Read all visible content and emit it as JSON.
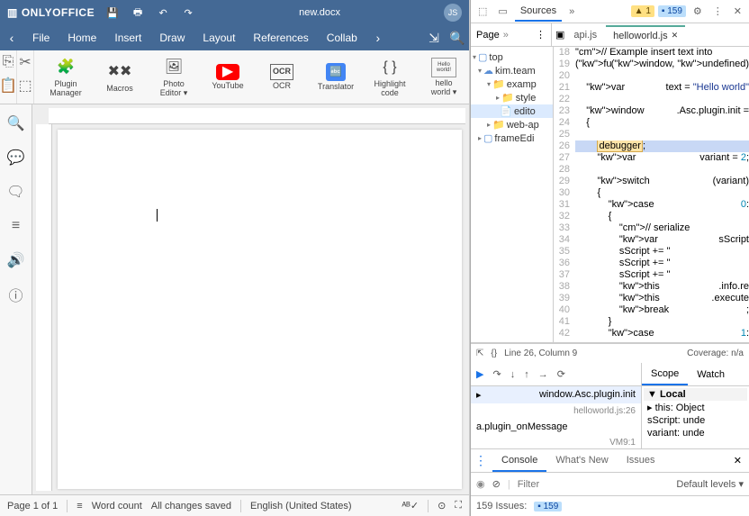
{
  "app": {
    "brand": "ONLYOFFICE",
    "filename": "new.docx",
    "avatar": "JS",
    "menu": [
      "File",
      "Home",
      "Insert",
      "Draw",
      "Layout",
      "References",
      "Collab"
    ],
    "toolbar": [
      {
        "label": "Plugin\nManager",
        "icon": "puzzle"
      },
      {
        "label": "Macros",
        "icon": "macros"
      },
      {
        "label": "Photo\nEditor ▾",
        "icon": "photo"
      },
      {
        "label": "YouTube",
        "icon": "youtube"
      },
      {
        "label": "OCR",
        "icon": "ocr"
      },
      {
        "label": "Translator",
        "icon": "translate"
      },
      {
        "label": "Highlight\ncode",
        "icon": "braces"
      },
      {
        "label": "hello\nworld ▾",
        "icon": "hello"
      }
    ],
    "status": {
      "page": "Page 1 of 1",
      "wordcount": "Word count",
      "saved": "All changes saved",
      "lang": "English (United States)"
    }
  },
  "dev": {
    "top_tab": "Sources",
    "warn_count": "1",
    "info_count": "159",
    "sub_left": "Page",
    "file_tabs": [
      {
        "name": "api.js",
        "active": false
      },
      {
        "name": "helloworld.js",
        "active": true
      }
    ],
    "tree": [
      {
        "t": "top",
        "ind": 0,
        "tri": "▾",
        "ic": "▢"
      },
      {
        "t": "kim.team",
        "ind": 1,
        "tri": "▾",
        "ic": "☁"
      },
      {
        "t": "examp",
        "ind": 2,
        "tri": "▾",
        "ic": "📁"
      },
      {
        "t": "style",
        "ind": 3,
        "tri": "▸",
        "ic": "📁"
      },
      {
        "t": "edito",
        "ind": 3,
        "tri": "",
        "ic": "📄",
        "sel": true
      },
      {
        "t": "web-ap",
        "ind": 2,
        "tri": "▸",
        "ic": "📁"
      },
      {
        "t": "frameEdi",
        "ind": 1,
        "tri": "▸",
        "ic": "▢"
      }
    ],
    "code_start": 18,
    "code": [
      {
        "n": 18,
        "t": "// Example insert text into",
        "cls": "cm"
      },
      {
        "n": 19,
        "t": "(function(window, undefined)"
      },
      {
        "n": 20,
        "t": ""
      },
      {
        "n": 21,
        "t": "    var text = \"Hello world\""
      },
      {
        "n": 22,
        "t": ""
      },
      {
        "n": 23,
        "t": "    window.Asc.plugin.init ="
      },
      {
        "n": 24,
        "t": "    {"
      },
      {
        "n": 25,
        "t": ""
      },
      {
        "n": 26,
        "t": "        debugger;",
        "hl": true,
        "dbg": true
      },
      {
        "n": 27,
        "t": "        var variant = 2;"
      },
      {
        "n": 28,
        "t": ""
      },
      {
        "n": 29,
        "t": "        switch (variant)"
      },
      {
        "n": 30,
        "t": "        {"
      },
      {
        "n": 31,
        "t": "            case 0:"
      },
      {
        "n": 32,
        "t": "            {"
      },
      {
        "n": 33,
        "t": "                // serialize"
      },
      {
        "n": 34,
        "t": "                var sScript"
      },
      {
        "n": 35,
        "t": "                sScript += \""
      },
      {
        "n": 36,
        "t": "                sScript += \""
      },
      {
        "n": 37,
        "t": "                sScript += \""
      },
      {
        "n": 38,
        "t": "                this.info.re"
      },
      {
        "n": 39,
        "t": "                this.execute"
      },
      {
        "n": 40,
        "t": "                break;"
      },
      {
        "n": 41,
        "t": "            }"
      },
      {
        "n": 42,
        "t": "            case 1:"
      }
    ],
    "code_status": {
      "pos": "Line 26, Column 9",
      "cov": "Coverage: n/a"
    },
    "callstack": [
      {
        "fn": "window.Asc.plugin.init",
        "loc": "helloworld.js:26",
        "sel": true
      },
      {
        "fn": "a.plugin_onMessage",
        "loc": "VM9:1"
      }
    ],
    "scope_tabs": [
      "Scope",
      "Watch"
    ],
    "scope": [
      {
        "t": "▼ Local",
        "hdr": true
      },
      {
        "t": "  ▸ this: Object"
      },
      {
        "t": "    sScript: unde"
      },
      {
        "t": "    variant: unde"
      }
    ],
    "console_tabs": [
      "Console",
      "What's New",
      "Issues"
    ],
    "filter_placeholder": "Filter",
    "levels": "Default levels ▾",
    "issues": "159 Issues:",
    "issues_badge": "159"
  }
}
